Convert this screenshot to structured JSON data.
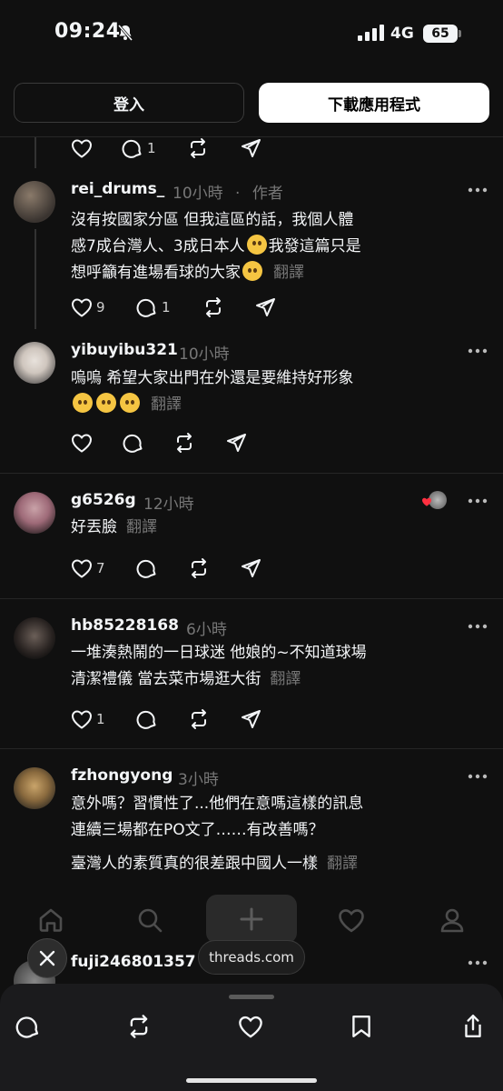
{
  "status_bar": {
    "time": "09:24",
    "network": "4G",
    "battery": "65"
  },
  "auth": {
    "login_label": "登入",
    "download_label": "下載應用程式"
  },
  "prev_post": {
    "reply_count": "1"
  },
  "posts": [
    {
      "username": "rei_drums_",
      "time": "10小時",
      "separator": "·",
      "author_tag": "作者",
      "lines": [
        "沒有按國家分區 但我這區的話，我個人體",
        "感7成台灣人、3成日本人",
        "我發這篇只是",
        "想呼籲有進場看球的大家"
      ],
      "translate": "翻譯",
      "like_count": "9",
      "reply_count": "1"
    },
    {
      "username": "yibuyibu321",
      "time": "10小時",
      "lines": [
        "嗚嗚 希望大家出門在外還是要維持好形象"
      ],
      "translate": "翻譯"
    },
    {
      "username": "g6526g",
      "time": "12小時",
      "lines": [
        "好丟臉"
      ],
      "translate": "翻譯",
      "like_count": "7"
    },
    {
      "username": "hb85228168",
      "time": "6小時",
      "lines": [
        "一堆湊熱鬧的一日球迷 他娘的~不知道球場",
        "清潔禮儀 當去菜市場逛大街"
      ],
      "translate": "翻譯",
      "like_count": "1"
    },
    {
      "username": "fzhongyong",
      "time": "3小時",
      "lines": [
        "意外嗎？習慣性了...他們在意嗎這樣的訊息",
        "連續三場都在PO文了……有改善嗎？",
        "臺灣人的素質真的很差跟中國人一樣"
      ],
      "translate": "翻譯"
    },
    {
      "username": "fuji246801357"
    }
  ],
  "overlay": {
    "url": "threads.com"
  },
  "icons": {
    "like": "heart-icon",
    "reply": "comment-icon",
    "repost": "repost-icon",
    "share": "send-icon",
    "more": "more-icon",
    "home": "home-icon",
    "search": "search-icon",
    "create": "plus-icon",
    "activity": "heart-icon",
    "profile": "profile-icon"
  }
}
